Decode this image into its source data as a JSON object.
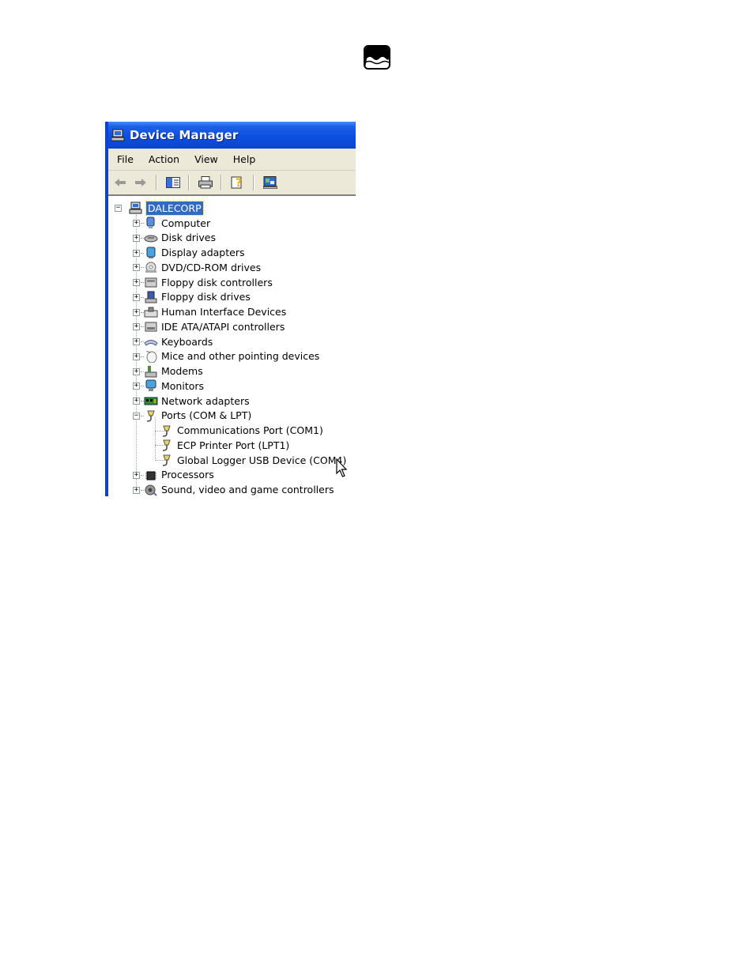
{
  "window": {
    "title": "Device Manager"
  },
  "menu": [
    "File",
    "Action",
    "View",
    "Help"
  ],
  "toolbar": {
    "icons": [
      "back-icon",
      "forward-icon",
      "show-hide-tree-icon",
      "print-icon",
      "help-icon",
      "properties-icon"
    ]
  },
  "tree": {
    "root": "DALECORP",
    "categories": [
      {
        "label": "Computer",
        "icon": "computer-icon"
      },
      {
        "label": "Disk drives",
        "icon": "disk-drive-icon"
      },
      {
        "label": "Display adapters",
        "icon": "display-adapter-icon"
      },
      {
        "label": "DVD/CD-ROM drives",
        "icon": "cd-drive-icon"
      },
      {
        "label": "Floppy disk controllers",
        "icon": "controller-icon"
      },
      {
        "label": "Floppy disk drives",
        "icon": "floppy-icon"
      },
      {
        "label": "Human Interface Devices",
        "icon": "hid-icon"
      },
      {
        "label": "IDE ATA/ATAPI controllers",
        "icon": "ide-icon"
      },
      {
        "label": "Keyboards",
        "icon": "keyboard-icon"
      },
      {
        "label": "Mice and other pointing devices",
        "icon": "mouse-icon"
      },
      {
        "label": "Modems",
        "icon": "modem-icon"
      },
      {
        "label": "Monitors",
        "icon": "monitor-icon"
      },
      {
        "label": "Network adapters",
        "icon": "network-adapter-icon"
      },
      {
        "label": "Ports (COM & LPT)",
        "icon": "port-icon"
      }
    ],
    "ports_children": [
      "Communications Port (COM1)",
      "ECP Printer Port (LPT1)",
      "Global Logger USB Device (COM4)"
    ],
    "after_categories": [
      {
        "label": "Processors",
        "icon": "processor-icon"
      },
      {
        "label": "Sound, video and game controllers",
        "icon": "sound-icon"
      }
    ]
  },
  "colors": {
    "titlebar": "#0c50e0",
    "chrome": "#ece9d8",
    "selection": "#316ac5"
  }
}
